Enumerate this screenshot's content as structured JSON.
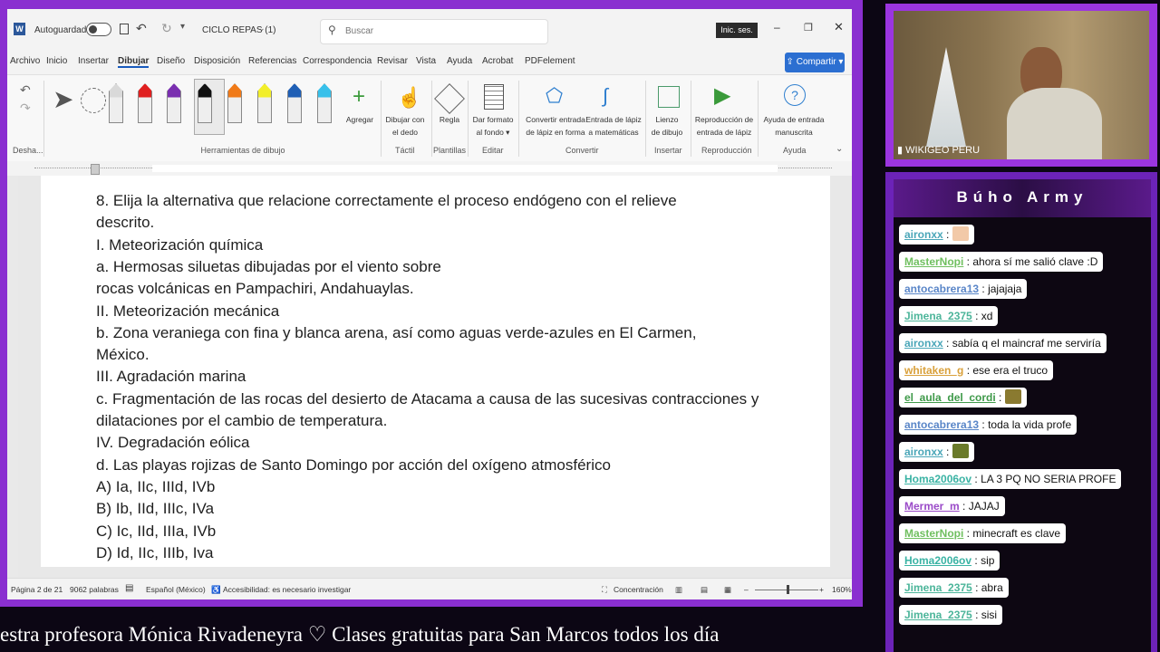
{
  "word": {
    "autosave_label": "Autoguardado",
    "doc_title": "CICLO REPAS (1)",
    "search_placeholder": "Buscar",
    "signin_label": "Inic. ses.",
    "share_label": "Compartir",
    "menu": [
      "Archivo",
      "Inicio",
      "Insertar",
      "Dibujar",
      "Diseño",
      "Disposición",
      "Referencias",
      "Correspondencia",
      "Revisar",
      "Vista",
      "Ayuda",
      "Acrobat",
      "PDFelement"
    ],
    "ribbon": {
      "group_undo": "Desha...",
      "group_tools": "Herramientas de dibujo",
      "add_label": "Agregar",
      "draw_finger_1": "Dibujar con",
      "draw_finger_2": "el dedo",
      "group_touch": "Táctil",
      "ruler_label": "Regla",
      "group_templates": "Plantillas",
      "format_bg_1": "Dar formato",
      "format_bg_2": "al fondo",
      "group_edit": "Editar",
      "convert_shape_1": "Convertir entrada",
      "convert_shape_2": "de lápiz en forma",
      "math_ink_1": "Entrada de lápiz",
      "math_ink_2": "a matemáticas",
      "group_convert": "Convertir",
      "canvas_1": "Lienzo",
      "canvas_2": "de dibujo",
      "group_insert": "Insertar",
      "replay_1": "Reproducción de",
      "replay_2": "entrada de lápiz",
      "group_replay": "Reproducción",
      "help_1": "Ayuda de entrada",
      "help_2": "manuscrita",
      "group_help": "Ayuda"
    },
    "pen_colors": [
      "#d9d9d9",
      "#e02020",
      "#7a2fb0",
      "#111111",
      "#f07a18",
      "#f2ee2a",
      "#1f5fb5",
      "#38c0ea"
    ],
    "document_lines": [
      "8. Elija la alternativa que relacione correctamente el proceso endógeno con el relieve",
      "descrito.",
      "I. Meteorización química",
      "a. Hermosas siluetas dibujadas por el viento sobre",
      "rocas volcánicas en Pampachiri, Andahuaylas.",
      "II. Meteorización mecánica",
      "b. Zona veraniega con fina y blanca arena, así como aguas verde-azules en El Carmen,",
      "México.",
      "III. Agradación marina",
      "c. Fragmentación de las rocas del desierto de Atacama a causa de las sucesivas contracciones y",
      "dilataciones por el cambio de temperatura.",
      "IV. Degradación eólica",
      "d. Las playas rojizas de Santo Domingo por acción del oxígeno atmosférico",
      "A) Ia, IIc, IIId, IVb",
      "B) Ib, IId, IIIc, IVa",
      "C) Ic, IId, IIIa, IVb",
      "D) Id, IIc, IIIb, Iva"
    ],
    "status": {
      "page": "Página 2 de 21",
      "words": "9062 palabras",
      "language": "Español (México)",
      "accessibility": "Accesibilidad: es necesario investigar",
      "focus": "Concentración",
      "zoom": "160%"
    }
  },
  "ticker_text": "estra profesora Mónica Rivadeneyra  ♡         Clases gratuitas para San Marcos todos los día",
  "webcam_label": "WIKIGEO PERU",
  "chat": {
    "title": "Búho Army",
    "messages": [
      {
        "user": "aironxx",
        "text": "",
        "color": "#4aa6b8",
        "emote": "#f2c9a8"
      },
      {
        "user": "MasterNopi",
        "text": "ahora sí me salió clave :D",
        "color": "#6fbf5f",
        "emote": ""
      },
      {
        "user": "antocabrera13",
        "text": "jajajaja",
        "color": "#5a86c8",
        "emote": ""
      },
      {
        "user": "Jimena_2375",
        "text": "xd",
        "color": "#4cb59a",
        "emote": ""
      },
      {
        "user": "aironxx",
        "text": "sabía q el maincraf me serviría",
        "color": "#4aa6b8",
        "emote": ""
      },
      {
        "user": "whitaken_g",
        "text": "ese era el truco",
        "color": "#d9a03a",
        "emote": ""
      },
      {
        "user": "el_aula_del_cordi",
        "text": "",
        "color": "#3f9a4a",
        "emote": "#8a7a30"
      },
      {
        "user": "antocabrera13",
        "text": "toda la vida profe",
        "color": "#5a86c8",
        "emote": ""
      },
      {
        "user": "aironxx",
        "text": "",
        "color": "#4aa6b8",
        "emote": "#6a7a2a"
      },
      {
        "user": "Homa2006ov",
        "text": "LA 3 PQ NO SERIA PROFE",
        "color": "#3ab3a4",
        "emote": ""
      },
      {
        "user": "Mermer_m",
        "text": "JAJAJ",
        "color": "#9a4ac8",
        "emote": ""
      },
      {
        "user": "MasterNopi",
        "text": "minecraft es clave",
        "color": "#6fbf5f",
        "emote": ""
      },
      {
        "user": "Homa2006ov",
        "text": "sip",
        "color": "#3ab3a4",
        "emote": ""
      },
      {
        "user": "Jimena_2375",
        "text": "abra",
        "color": "#4cb59a",
        "emote": ""
      },
      {
        "user": "Jimena_2375",
        "text": "sisi",
        "color": "#4cb59a",
        "emote": ""
      }
    ]
  }
}
